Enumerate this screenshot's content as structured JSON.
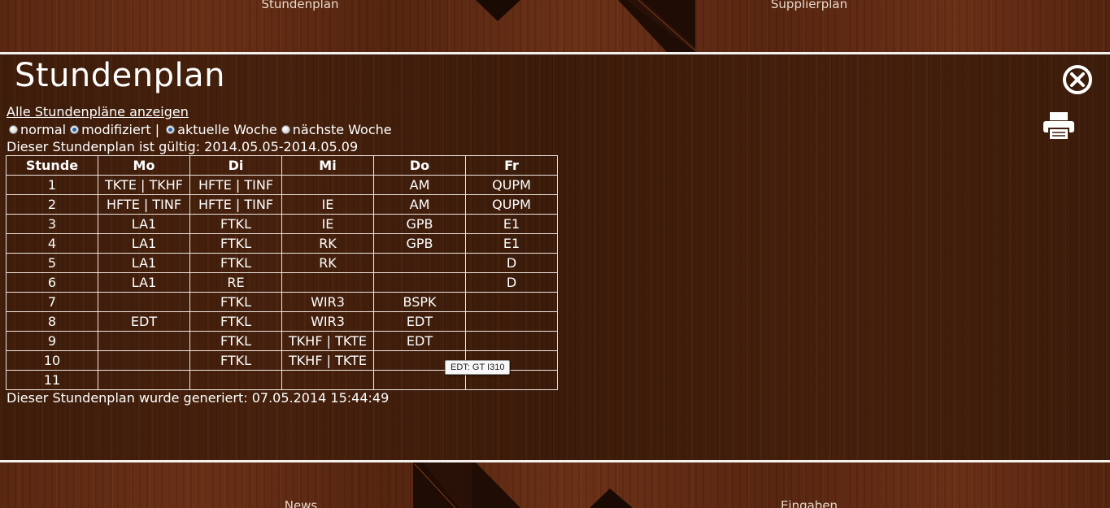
{
  "nav": {
    "top_left": "Stundenplan",
    "top_right": "Supplierplan",
    "bottom_left": "News",
    "bottom_right": "Eingaben"
  },
  "page": {
    "title": "Stundenplan",
    "show_all_link": "Alle Stundenpläne anzeigen",
    "options": {
      "normal": "normal",
      "modified": "modifiziert |",
      "current_week": "aktuelle Woche",
      "next_week": "nächste Woche",
      "selected_mode": "modifiziert",
      "selected_week": "aktuelle Woche"
    },
    "validity": "Dieser Stundenplan ist gültig: 2014.05.05-2014.05.09",
    "generated": "Dieser Stundenplan wurde generiert: 07.05.2014 15:44:49",
    "tooltip": "EDT: GT I310"
  },
  "timetable": {
    "headers": [
      "Stunde",
      "Mo",
      "Di",
      "Mi",
      "Do",
      "Fr"
    ],
    "rows": [
      [
        "1",
        "TKTE | TKHF",
        "HFTE | TINF",
        "",
        "AM",
        "QUPM"
      ],
      [
        "2",
        "HFTE | TINF",
        "HFTE | TINF",
        "IE",
        "AM",
        "QUPM"
      ],
      [
        "3",
        "LA1",
        "FTKL",
        "IE",
        "GPB",
        "E1"
      ],
      [
        "4",
        "LA1",
        "FTKL",
        "RK",
        "GPB",
        "E1"
      ],
      [
        "5",
        "LA1",
        "FTKL",
        "RK",
        "",
        "D"
      ],
      [
        "6",
        "LA1",
        "RE",
        "",
        "",
        "D"
      ],
      [
        "7",
        "",
        "FTKL",
        "WIR3",
        "BSPK",
        ""
      ],
      [
        "8",
        "EDT",
        "FTKL",
        "WIR3",
        "EDT",
        ""
      ],
      [
        "9",
        "",
        "FTKL",
        "TKHF | TKTE",
        "EDT",
        ""
      ],
      [
        "10",
        "",
        "FTKL",
        "TKHF | TKTE",
        "",
        ""
      ],
      [
        "11",
        "",
        "",
        "",
        "",
        ""
      ]
    ]
  },
  "icons": {
    "close": "close-icon",
    "print": "printer-icon"
  },
  "colors": {
    "divider": "#f4f0ee",
    "text": "#ffffff",
    "panel": "#3f1d0b"
  }
}
